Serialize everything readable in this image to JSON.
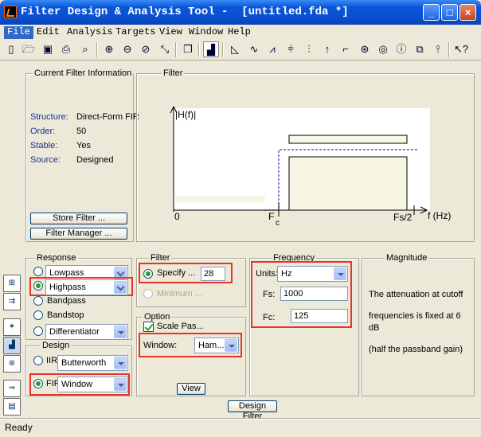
{
  "window": {
    "title": "Filter Design & Analysis Tool -  [untitled.fda *]"
  },
  "menu": [
    "File",
    "Edit",
    "Analysis",
    "Targets",
    "View",
    "Window",
    "Help"
  ],
  "toolbar_icons": [
    "new-icon",
    "open-icon",
    "save-icon",
    "print-icon",
    "print-preview-icon",
    "zoom-in-icon",
    "zoom-out-icon",
    "zoom-x-icon",
    "full-view-icon",
    "new-figure-icon",
    "filter-specs-icon",
    "magnitude-response-icon",
    "phase-response-icon",
    "mag-phase-icon",
    "group-delay-icon",
    "impulse-response-icon",
    "step-response-icon",
    "pole-zero-icon",
    "coefficients-icon",
    "info-icon",
    "export-icon",
    "freq-response-icon",
    "whats-this-icon"
  ],
  "info": {
    "title": "Current Filter Information",
    "rows": [
      {
        "label": "Structure:",
        "value": "Direct-Form FIR"
      },
      {
        "label": "Order:",
        "value": "50"
      },
      {
        "label": "Stable:",
        "value": "Yes"
      },
      {
        "label": "Source:",
        "value": "Designed"
      }
    ],
    "store_btn": "Store Filter ...",
    "manager_btn": "Filter Manager ..."
  },
  "filter_panel": {
    "title": "Filter",
    "ylabel": "|H(f)|",
    "x0": "0",
    "fc": "F",
    "fc_sub": "c",
    "fs2": "Fs/2",
    "xlabel": "f (Hz)"
  },
  "response": {
    "title": "Response",
    "lowpass": "Lowpass",
    "highpass": "Highpass",
    "bandpass": "Bandpass",
    "bandstop": "Bandstop",
    "differentiator": "Differentiator"
  },
  "design": {
    "title": "Design",
    "iir": "IIR",
    "iir_method": "Butterworth",
    "fir": "FIR",
    "fir_method": "Window"
  },
  "filter_order": {
    "title": "Filter",
    "specify": "Specify ...",
    "order": "28",
    "minimum": "Minimum ..."
  },
  "options": {
    "title": "Option",
    "scale": "Scale Pas...",
    "window_label": "Window:",
    "window": "Ham...",
    "view_btn": "View"
  },
  "frequency": {
    "title": "Frequency",
    "units_label": "Units:",
    "units": "Hz",
    "fs_label": "Fs:",
    "fs": "1000",
    "fc_label": "Fc:",
    "fc": "125"
  },
  "magnitude": {
    "title": "Magnitude",
    "line1": "The attenuation at cutoff",
    "line2": "frequencies is fixed at 6",
    "line3": "dB",
    "line4": "(half the passband gain)"
  },
  "design_btn": "Design Filter",
  "status": "Ready"
}
